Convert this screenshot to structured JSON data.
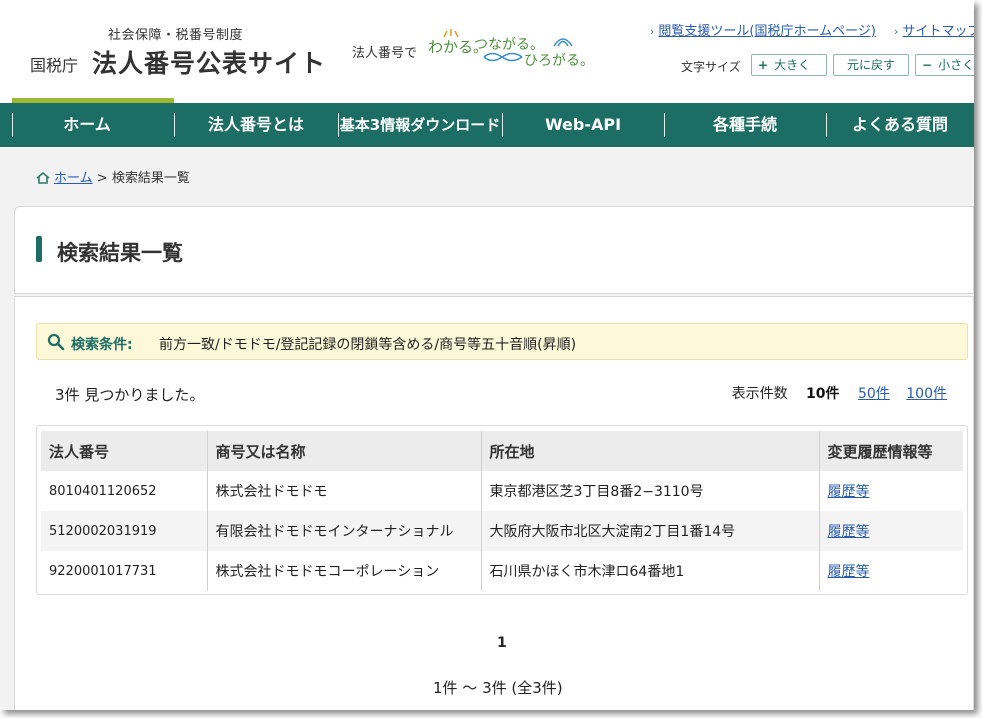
{
  "header": {
    "logo_sub": "社会保障・税番号制度",
    "logo_agency": "国税庁",
    "logo_main": "法人番号公表サイト",
    "tagline": {
      "prefix": "法人番号で",
      "word1": "わかる。",
      "word2": "つながる。",
      "word3": "ひろがる。"
    },
    "util_links": [
      "閲覧支援ツール(国税庁ホームページ)",
      "サイトマップ"
    ],
    "font_size": {
      "label": "文字サイズ",
      "bigger": "大きく",
      "reset": "元に戻す",
      "smaller": "小さく",
      "plus": "+",
      "minus": "−"
    }
  },
  "nav": {
    "items": [
      "ホーム",
      "法人番号とは",
      "基本3情報ダウンロード",
      "Web-API",
      "各種手続",
      "よくある質問"
    ]
  },
  "breadcrumb": {
    "home": "ホーム",
    "sep": ">",
    "current": "検索結果一覧"
  },
  "page_title": "検索結果一覧",
  "search_condition": {
    "label": "検索条件:",
    "text": "前方一致/ドモドモ/登記記録の閉鎖等含める/商号等五十音順(昇順)"
  },
  "results": {
    "found_count": "3",
    "found_suffix": "件 見つかりました。",
    "per_page_label": "表示件数",
    "per_page_current": "10件",
    "per_page_options": [
      "50件",
      "100件"
    ]
  },
  "table": {
    "headers": [
      "法人番号",
      "商号又は名称",
      "所在地",
      "変更履歴情報等"
    ],
    "rows": [
      [
        "8010401120652",
        "株式会社ドモドモ",
        "東京都港区芝3丁目8番2−3110号",
        "履歴等"
      ],
      [
        "5120002031919",
        "有限会社ドモドモインターナショナル",
        "大阪府大阪市北区大淀南2丁目1番14号",
        "履歴等"
      ],
      [
        "9220001017731",
        "株式会社ドモドモコーポレーション",
        "石川県かほく市木津ロ64番地1",
        "履歴等"
      ]
    ]
  },
  "pagination": {
    "current_page": "1",
    "range_text": "1件 〜 3件 (全3件)"
  },
  "colors": {
    "nav_green": "#1c6d64",
    "accent_lime": "#9cb832",
    "link_blue": "#2a5db0",
    "condition_bg": "#fdf8d8"
  }
}
